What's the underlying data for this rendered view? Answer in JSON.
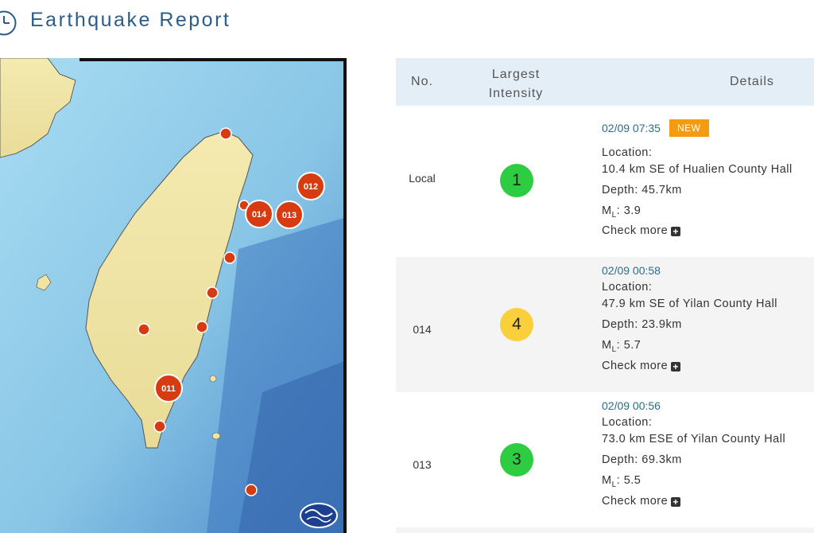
{
  "header": {
    "title": "Earthquake Report"
  },
  "table": {
    "headers": {
      "no": "No.",
      "intensity_line1": "Largest",
      "intensity_line2": "Intensity",
      "details": "Details"
    },
    "location_label": "Location:",
    "check_more_label": "Check more",
    "rows": [
      {
        "no": "Local",
        "intensity": "1",
        "intensity_color": "#2ecc40",
        "time": "02/09 07:35",
        "new_label": "NEW",
        "location": "10.4 km SE of Hualien County Hall",
        "depth": "Depth: 45.7km",
        "ml_label": "M",
        "ml_sub": "L",
        "ml_value": ": 3.9"
      },
      {
        "no": "014",
        "intensity": "4",
        "intensity_color": "#f9cf3b",
        "time": "02/09 00:58",
        "location": "47.9 km SE of Yilan County Hall",
        "depth": "Depth: 23.9km",
        "ml_label": "M",
        "ml_sub": "L",
        "ml_value": ": 5.7"
      },
      {
        "no": "013",
        "intensity": "3",
        "intensity_color": "#2ecc40",
        "time": "02/09 00:56",
        "location": "73.0 km ESE of Yilan County Hall",
        "depth": "Depth: 69.3km",
        "ml_label": "M",
        "ml_sub": "L",
        "ml_value": ": 5.5"
      }
    ]
  },
  "map": {
    "labeled_markers": [
      "012",
      "014",
      "013",
      "011"
    ],
    "marker_color": "#d63b12"
  }
}
